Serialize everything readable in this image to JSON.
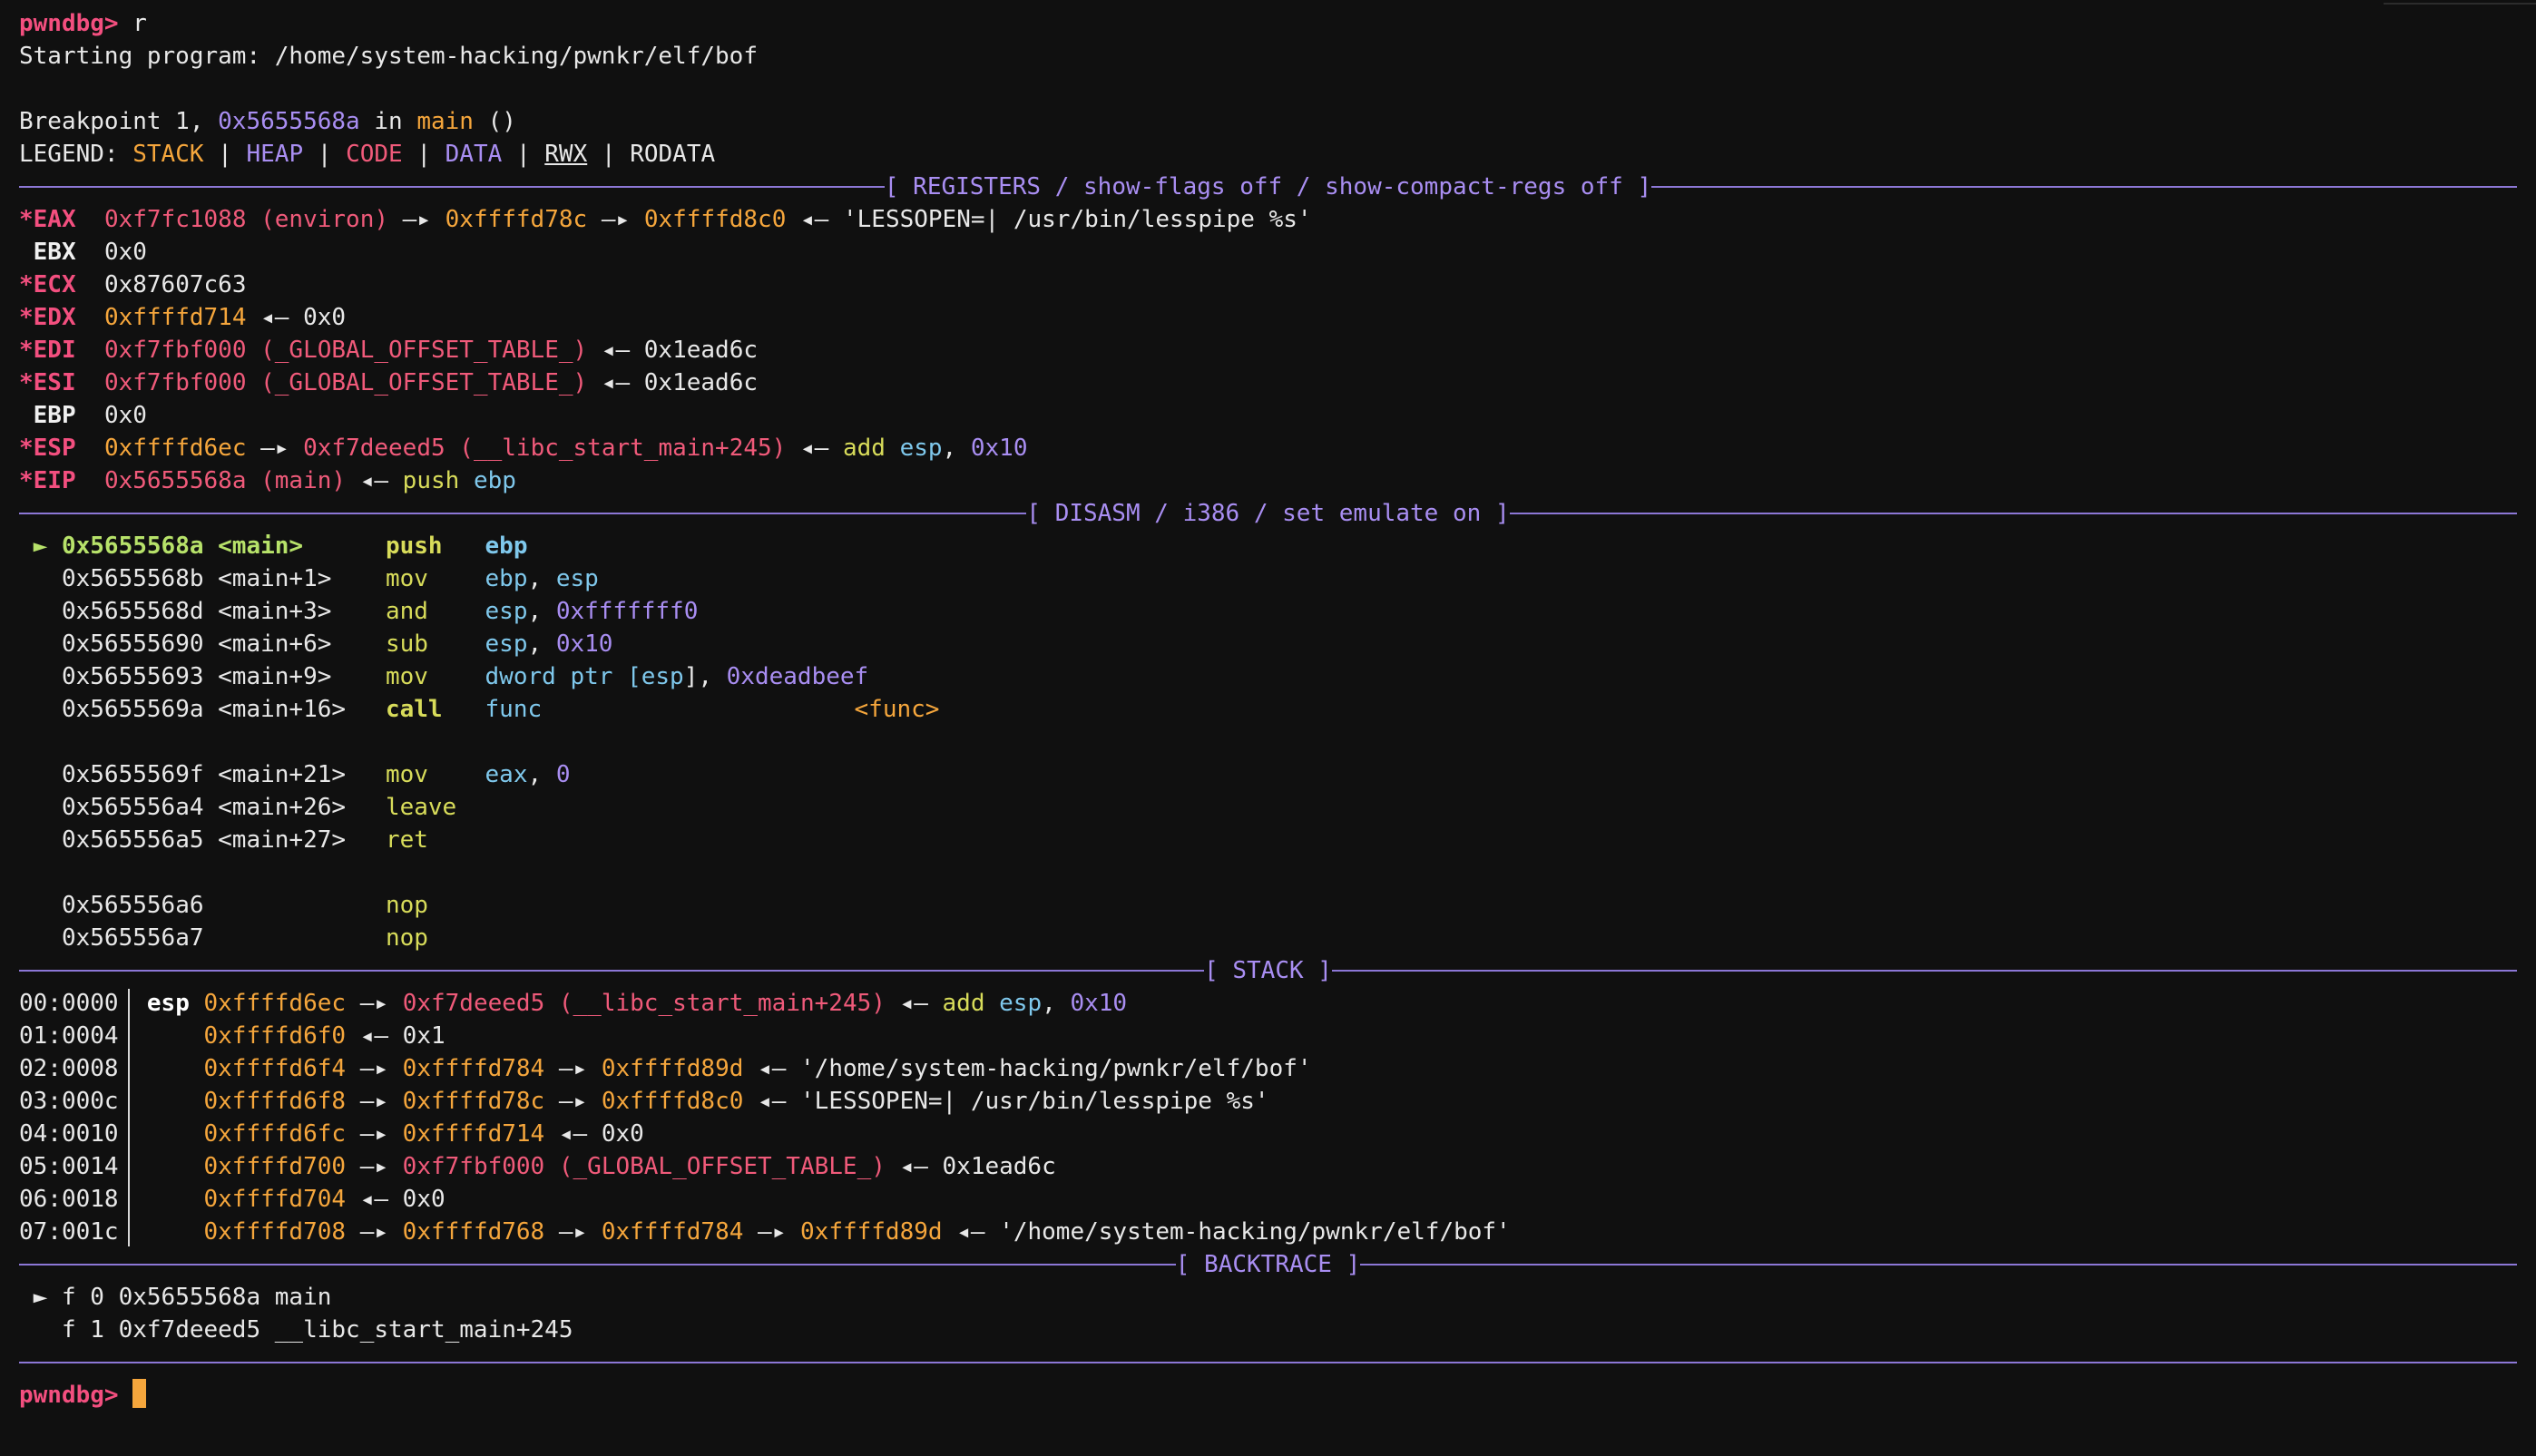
{
  "colors": {
    "prompt": "#f34f7f",
    "separator": "#8c77d6",
    "stack": "#f5a63c",
    "heap": "#a98ef2",
    "code": "#f05a7a",
    "data": "#a98ef2",
    "mnemonic": "#d8dc5a",
    "register": "#7fc8ec",
    "cursor": "#f5a63c"
  },
  "prompt": "pwndbg> ",
  "cmd": "r",
  "starting": "Starting program: /home/system-hacking/pwnkr/elf/bof",
  "bp": {
    "pre": "Breakpoint 1, ",
    "addr": "0x5655568a",
    "mid": " in ",
    "func": "main",
    "post": " ()"
  },
  "legend": {
    "label": "LEGEND: ",
    "stack": "STACK",
    "heap": "HEAP",
    "code": "CODE",
    "data": "DATA",
    "rwx": "RWX",
    "rodata": "RODATA",
    "sep": " | "
  },
  "headers": {
    "registers": "[ REGISTERS / show-flags off / show-compact-regs off ]",
    "disasm": "[ DISASM / i386 / set emulate on ]",
    "stack": "[ STACK ]",
    "backtrace": "[ BACKTRACE ]"
  },
  "regs": {
    "eax": {
      "n": "*EAX",
      "v1": "0xf7fc1088 (environ)",
      "a1": " —▸ ",
      "v2": "0xffffd78c",
      "a2": " —▸ ",
      "v3": "0xffffd8c0",
      "a3": " ◂— ",
      "str": "'LESSOPEN=| /usr/bin/lesspipe %s'"
    },
    "ebx": {
      "n": " EBX",
      "v": "0x0"
    },
    "ecx": {
      "n": "*ECX",
      "v": "0x87607c63"
    },
    "edx": {
      "n": "*EDX",
      "v": "0xffffd714",
      "a": " ◂— ",
      "r": "0x0"
    },
    "edi": {
      "n": "*EDI",
      "v": "0xf7fbf000 (_GLOBAL_OFFSET_TABLE_)",
      "a": " ◂— ",
      "r": "0x1ead6c"
    },
    "esi": {
      "n": "*ESI",
      "v": "0xf7fbf000 (_GLOBAL_OFFSET_TABLE_)",
      "a": " ◂— ",
      "r": "0x1ead6c"
    },
    "ebp": {
      "n": " EBP",
      "v": "0x0"
    },
    "esp": {
      "n": "*ESP",
      "v": "0xffffd6ec",
      "a1": " —▸ ",
      "v2": "0xf7deeed5 (__libc_start_main+245)",
      "a2": " ◂— ",
      "ins": "add",
      "op1": "esp",
      "comma": ", ",
      "op2": "0x10"
    },
    "eip": {
      "n": "*EIP",
      "v": "0x5655568a (main)",
      "a": " ◂— ",
      "ins": "push",
      "op": "ebp"
    }
  },
  "disasm": {
    "marker": "►",
    "l1": {
      "addr": "0x5655568a <main>",
      "m": "push",
      "op": "ebp"
    },
    "l2": {
      "addr": "0x5655568b <main+1>",
      "m": "mov",
      "o1": "ebp",
      "c": ", ",
      "o2": "esp"
    },
    "l3": {
      "addr": "0x5655568d <main+3>",
      "m": "and",
      "o1": "esp",
      "c": ", ",
      "o2": "0xfffffff0"
    },
    "l4": {
      "addr": "0x56555690 <main+6>",
      "m": "sub",
      "o1": "esp",
      "c": ", ",
      "o2": "0x10"
    },
    "l5": {
      "addr": "0x56555693 <main+9>",
      "m": "mov",
      "a": "dword ptr [",
      "r": "esp",
      "b": "], ",
      "o2": "0xdeadbeef"
    },
    "l6": {
      "addr": "0x5655569a <main+16>",
      "m": "call",
      "op": "func",
      "target": "<func>"
    },
    "l7": {
      "addr": "0x5655569f <main+21>",
      "m": "mov",
      "o1": "eax",
      "c": ", ",
      "o2": "0"
    },
    "l8": {
      "addr": "0x565556a4 <main+26>",
      "m": "leave"
    },
    "l9": {
      "addr": "0x565556a5 <main+27>",
      "m": "ret"
    },
    "l10": {
      "addr": "0x565556a6",
      "m": "nop"
    },
    "l11": {
      "addr": "0x565556a7",
      "m": "nop"
    }
  },
  "stack": {
    "s0": {
      "off": "00:0000",
      "reg": "esp",
      "v": "0xffffd6ec",
      "a1": " —▸ ",
      "v2": "0xf7deeed5 (__libc_start_main+245)",
      "a2": " ◂— ",
      "ins": "add",
      "op1": "esp",
      "c": ", ",
      "op2": "0x10"
    },
    "s1": {
      "off": "01:0004",
      "v": "0xffffd6f0",
      "a": " ◂— ",
      "r": "0x1"
    },
    "s2": {
      "off": "02:0008",
      "v": "0xffffd6f4",
      "a1": " —▸ ",
      "v2": "0xffffd784",
      "a2": " —▸ ",
      "v3": "0xffffd89d",
      "a3": " ◂— ",
      "str": "'/home/system-hacking/pwnkr/elf/bof'"
    },
    "s3": {
      "off": "03:000c",
      "v": "0xffffd6f8",
      "a1": " —▸ ",
      "v2": "0xffffd78c",
      "a2": " —▸ ",
      "v3": "0xffffd8c0",
      "a3": " ◂— ",
      "str": "'LESSOPEN=| /usr/bin/lesspipe %s'"
    },
    "s4": {
      "off": "04:0010",
      "v": "0xffffd6fc",
      "a1": " —▸ ",
      "v2": "0xffffd714",
      "a2": " ◂— ",
      "r": "0x0"
    },
    "s5": {
      "off": "05:0014",
      "v": "0xffffd700",
      "a1": " —▸ ",
      "v2": "0xf7fbf000 (_GLOBAL_OFFSET_TABLE_)",
      "a2": " ◂— ",
      "r": "0x1ead6c"
    },
    "s6": {
      "off": "06:0018",
      "v": "0xffffd704",
      "a": " ◂— ",
      "r": "0x0"
    },
    "s7": {
      "off": "07:001c",
      "v": "0xffffd708",
      "a1": " —▸ ",
      "v2": "0xffffd768",
      "a2": " —▸ ",
      "v3": "0xffffd784",
      "a3": " —▸ ",
      "v4": "0xffffd89d",
      "a4": " ◂— ",
      "str": "'/home/system-hacking/pwnkr/elf/bof'"
    }
  },
  "backtrace": {
    "marker": "►",
    "f0": "f 0 0x5655568a main",
    "f1": "f 1 0xf7deeed5 __libc_start_main+245"
  }
}
